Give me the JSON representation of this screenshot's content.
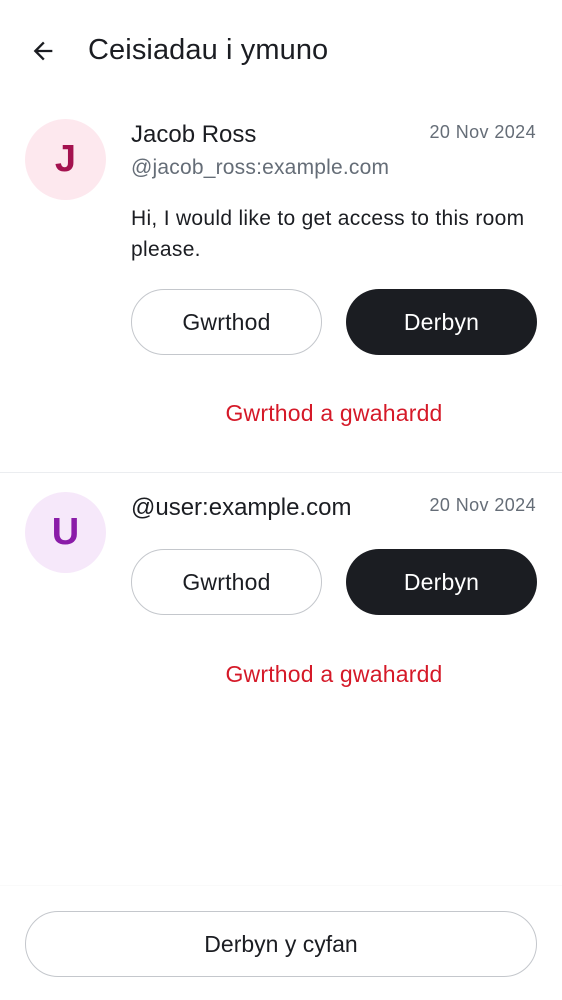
{
  "header": {
    "title": "Ceisiadau i ymuno",
    "back_icon": "arrow-left-icon"
  },
  "requests": [
    {
      "avatar_letter": "J",
      "avatar_bg": "#fde8ee",
      "avatar_color": "#a4124f",
      "name": "Jacob Ross",
      "handle": "@jacob_ross:example.com",
      "date": "20 Nov 2024",
      "message": "Hi, I would like to get access to this room please.",
      "decline_label": "Gwrthod",
      "accept_label": "Derbyn",
      "ban_label": "Gwrthod a gwahardd"
    },
    {
      "avatar_letter": "U",
      "avatar_bg": "#f6e8fa",
      "avatar_color": "#8a1ca8",
      "name": "@user:example.com",
      "date": "20 Nov 2024",
      "decline_label": "Gwrthod",
      "accept_label": "Derbyn",
      "ban_label": "Gwrthod a gwahardd"
    }
  ],
  "footer": {
    "accept_all_label": "Derbyn y cyfan"
  },
  "colors": {
    "primary_text": "#1b1d22",
    "secondary_text": "#656d77",
    "critical": "#d51928"
  }
}
